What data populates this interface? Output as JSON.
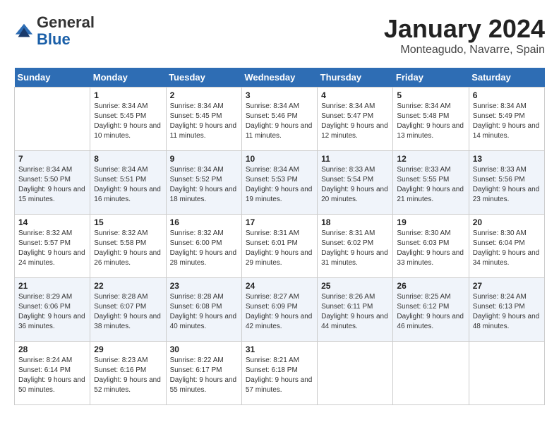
{
  "header": {
    "logo": {
      "general": "General",
      "blue": "Blue"
    },
    "title": "January 2024",
    "subtitle": "Monteagudo, Navarre, Spain"
  },
  "days_of_week": [
    "Sunday",
    "Monday",
    "Tuesday",
    "Wednesday",
    "Thursday",
    "Friday",
    "Saturday"
  ],
  "weeks": [
    [
      {
        "day": "",
        "sunrise": "",
        "sunset": "",
        "daylight": ""
      },
      {
        "day": "1",
        "sunrise": "Sunrise: 8:34 AM",
        "sunset": "Sunset: 5:45 PM",
        "daylight": "Daylight: 9 hours and 10 minutes."
      },
      {
        "day": "2",
        "sunrise": "Sunrise: 8:34 AM",
        "sunset": "Sunset: 5:45 PM",
        "daylight": "Daylight: 9 hours and 11 minutes."
      },
      {
        "day": "3",
        "sunrise": "Sunrise: 8:34 AM",
        "sunset": "Sunset: 5:46 PM",
        "daylight": "Daylight: 9 hours and 11 minutes."
      },
      {
        "day": "4",
        "sunrise": "Sunrise: 8:34 AM",
        "sunset": "Sunset: 5:47 PM",
        "daylight": "Daylight: 9 hours and 12 minutes."
      },
      {
        "day": "5",
        "sunrise": "Sunrise: 8:34 AM",
        "sunset": "Sunset: 5:48 PM",
        "daylight": "Daylight: 9 hours and 13 minutes."
      },
      {
        "day": "6",
        "sunrise": "Sunrise: 8:34 AM",
        "sunset": "Sunset: 5:49 PM",
        "daylight": "Daylight: 9 hours and 14 minutes."
      }
    ],
    [
      {
        "day": "7",
        "sunrise": "Sunrise: 8:34 AM",
        "sunset": "Sunset: 5:50 PM",
        "daylight": "Daylight: 9 hours and 15 minutes."
      },
      {
        "day": "8",
        "sunrise": "Sunrise: 8:34 AM",
        "sunset": "Sunset: 5:51 PM",
        "daylight": "Daylight: 9 hours and 16 minutes."
      },
      {
        "day": "9",
        "sunrise": "Sunrise: 8:34 AM",
        "sunset": "Sunset: 5:52 PM",
        "daylight": "Daylight: 9 hours and 18 minutes."
      },
      {
        "day": "10",
        "sunrise": "Sunrise: 8:34 AM",
        "sunset": "Sunset: 5:53 PM",
        "daylight": "Daylight: 9 hours and 19 minutes."
      },
      {
        "day": "11",
        "sunrise": "Sunrise: 8:33 AM",
        "sunset": "Sunset: 5:54 PM",
        "daylight": "Daylight: 9 hours and 20 minutes."
      },
      {
        "day": "12",
        "sunrise": "Sunrise: 8:33 AM",
        "sunset": "Sunset: 5:55 PM",
        "daylight": "Daylight: 9 hours and 21 minutes."
      },
      {
        "day": "13",
        "sunrise": "Sunrise: 8:33 AM",
        "sunset": "Sunset: 5:56 PM",
        "daylight": "Daylight: 9 hours and 23 minutes."
      }
    ],
    [
      {
        "day": "14",
        "sunrise": "Sunrise: 8:32 AM",
        "sunset": "Sunset: 5:57 PM",
        "daylight": "Daylight: 9 hours and 24 minutes."
      },
      {
        "day": "15",
        "sunrise": "Sunrise: 8:32 AM",
        "sunset": "Sunset: 5:58 PM",
        "daylight": "Daylight: 9 hours and 26 minutes."
      },
      {
        "day": "16",
        "sunrise": "Sunrise: 8:32 AM",
        "sunset": "Sunset: 6:00 PM",
        "daylight": "Daylight: 9 hours and 28 minutes."
      },
      {
        "day": "17",
        "sunrise": "Sunrise: 8:31 AM",
        "sunset": "Sunset: 6:01 PM",
        "daylight": "Daylight: 9 hours and 29 minutes."
      },
      {
        "day": "18",
        "sunrise": "Sunrise: 8:31 AM",
        "sunset": "Sunset: 6:02 PM",
        "daylight": "Daylight: 9 hours and 31 minutes."
      },
      {
        "day": "19",
        "sunrise": "Sunrise: 8:30 AM",
        "sunset": "Sunset: 6:03 PM",
        "daylight": "Daylight: 9 hours and 33 minutes."
      },
      {
        "day": "20",
        "sunrise": "Sunrise: 8:30 AM",
        "sunset": "Sunset: 6:04 PM",
        "daylight": "Daylight: 9 hours and 34 minutes."
      }
    ],
    [
      {
        "day": "21",
        "sunrise": "Sunrise: 8:29 AM",
        "sunset": "Sunset: 6:06 PM",
        "daylight": "Daylight: 9 hours and 36 minutes."
      },
      {
        "day": "22",
        "sunrise": "Sunrise: 8:28 AM",
        "sunset": "Sunset: 6:07 PM",
        "daylight": "Daylight: 9 hours and 38 minutes."
      },
      {
        "day": "23",
        "sunrise": "Sunrise: 8:28 AM",
        "sunset": "Sunset: 6:08 PM",
        "daylight": "Daylight: 9 hours and 40 minutes."
      },
      {
        "day": "24",
        "sunrise": "Sunrise: 8:27 AM",
        "sunset": "Sunset: 6:09 PM",
        "daylight": "Daylight: 9 hours and 42 minutes."
      },
      {
        "day": "25",
        "sunrise": "Sunrise: 8:26 AM",
        "sunset": "Sunset: 6:11 PM",
        "daylight": "Daylight: 9 hours and 44 minutes."
      },
      {
        "day": "26",
        "sunrise": "Sunrise: 8:25 AM",
        "sunset": "Sunset: 6:12 PM",
        "daylight": "Daylight: 9 hours and 46 minutes."
      },
      {
        "day": "27",
        "sunrise": "Sunrise: 8:24 AM",
        "sunset": "Sunset: 6:13 PM",
        "daylight": "Daylight: 9 hours and 48 minutes."
      }
    ],
    [
      {
        "day": "28",
        "sunrise": "Sunrise: 8:24 AM",
        "sunset": "Sunset: 6:14 PM",
        "daylight": "Daylight: 9 hours and 50 minutes."
      },
      {
        "day": "29",
        "sunrise": "Sunrise: 8:23 AM",
        "sunset": "Sunset: 6:16 PM",
        "daylight": "Daylight: 9 hours and 52 minutes."
      },
      {
        "day": "30",
        "sunrise": "Sunrise: 8:22 AM",
        "sunset": "Sunset: 6:17 PM",
        "daylight": "Daylight: 9 hours and 55 minutes."
      },
      {
        "day": "31",
        "sunrise": "Sunrise: 8:21 AM",
        "sunset": "Sunset: 6:18 PM",
        "daylight": "Daylight: 9 hours and 57 minutes."
      },
      {
        "day": "",
        "sunrise": "",
        "sunset": "",
        "daylight": ""
      },
      {
        "day": "",
        "sunrise": "",
        "sunset": "",
        "daylight": ""
      },
      {
        "day": "",
        "sunrise": "",
        "sunset": "",
        "daylight": ""
      }
    ]
  ]
}
